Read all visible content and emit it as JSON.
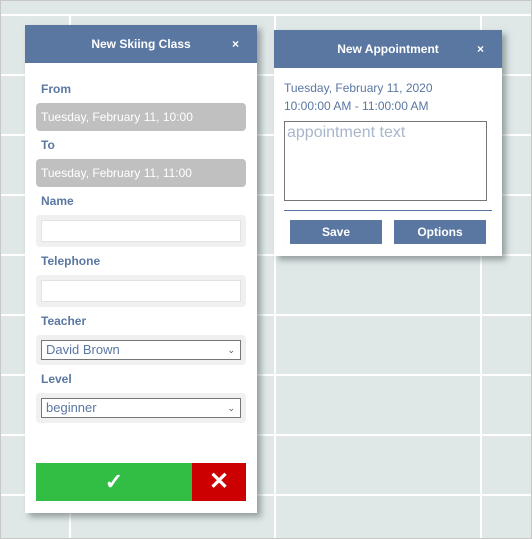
{
  "ski_form": {
    "title": "New Skiing Class",
    "close_icon": "×",
    "from_label": "From",
    "from_value": "Tuesday, February 11, 10:00",
    "to_label": "To",
    "to_value": "Tuesday, February 11, 11:00",
    "name_label": "Name",
    "name_value": "",
    "telephone_label": "Telephone",
    "telephone_value": "",
    "teacher_label": "Teacher",
    "teacher_selected": "David Brown",
    "level_label": "Level",
    "level_selected": "beginner",
    "ok_icon": "✓",
    "cancel_icon": "✕",
    "colors": {
      "ok": "#32bd45",
      "cancel": "#cc0000",
      "header": "#5a77a2"
    }
  },
  "appointment": {
    "title": "New Appointment",
    "close_icon": "×",
    "date": "Tuesday, February 11, 2020",
    "time_range": "10:00:00 AM - 11:00:00 AM",
    "text_placeholder": "appointment text",
    "text_value": "",
    "save_label": "Save",
    "options_label": "Options"
  }
}
